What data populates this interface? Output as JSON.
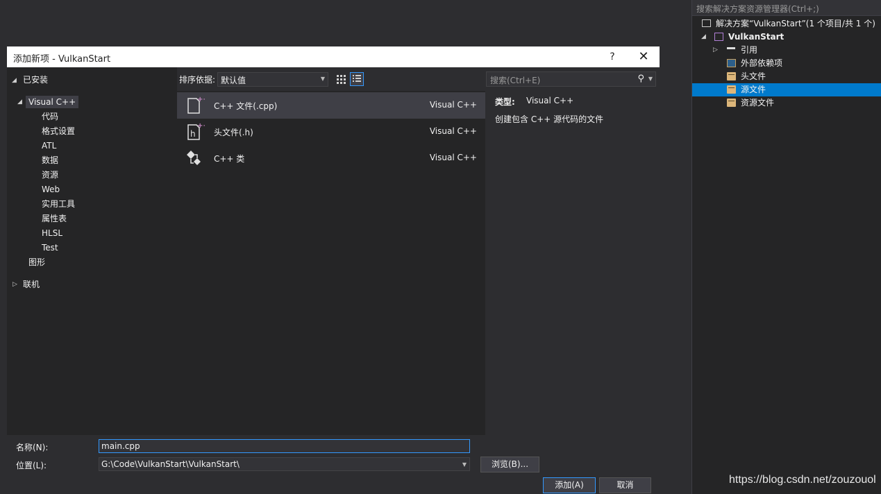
{
  "solution_explorer": {
    "search_placeholder": "搜索解决方案资源管理器(Ctrl+;)",
    "solution_label": "解决方案“VulkanStart”(1 个项目/共 1 个)",
    "project_label": "VulkanStart",
    "items": [
      {
        "label": "引用"
      },
      {
        "label": "外部依赖项"
      },
      {
        "label": "头文件"
      },
      {
        "label": "源文件"
      },
      {
        "label": "资源文件"
      }
    ]
  },
  "watermark": "https://blog.csdn.net/zouzouol",
  "dialog": {
    "title": "添加新项 - VulkanStart",
    "help": "?",
    "close": "✕",
    "tree": {
      "installed": "已安装",
      "visual_cpp": "Visual C++",
      "children": [
        "代码",
        "格式设置",
        "ATL",
        "数据",
        "资源",
        "Web",
        "实用工具",
        "属性表",
        "HLSL",
        "Test"
      ],
      "graphics": "图形",
      "online": "联机"
    },
    "sort": {
      "label": "排序依据:",
      "value": "默认值"
    },
    "search_placeholder": "搜索(Ctrl+E)",
    "items": [
      {
        "name": "C++ 文件(.cpp)",
        "type": "Visual C++"
      },
      {
        "name": "头文件(.h)",
        "type": "Visual C++"
      },
      {
        "name": "C++ 类",
        "type": "Visual C++"
      }
    ],
    "details": {
      "type_key": "类型:",
      "type_value": "Visual C++",
      "description": "创建包含 C++ 源代码的文件"
    },
    "name_label": "名称(N):",
    "name_value": "main.cpp",
    "location_label": "位置(L):",
    "location_value": "G:\\Code\\VulkanStart\\VulkanStart\\",
    "browse_label": "浏览(B)...",
    "add_label": "添加(A)",
    "cancel_label": "取消"
  },
  "colors": {
    "accent": "#007acc",
    "background": "#2d2d30",
    "panel": "#252526",
    "selection": "#3f3f46"
  }
}
